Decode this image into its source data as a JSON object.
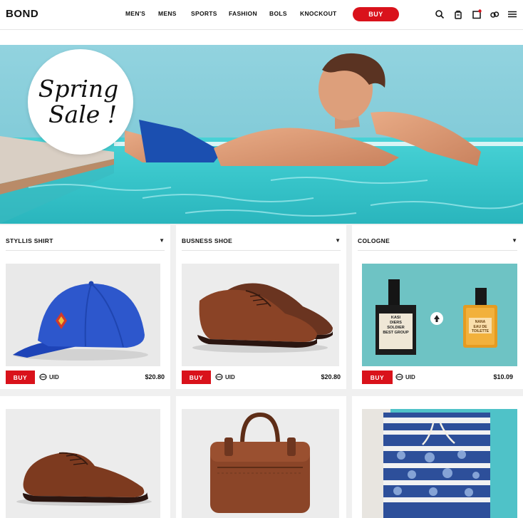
{
  "header": {
    "brand": "BOND",
    "nav": [
      "MEN'S",
      "MENS",
      "SPORTS",
      "FASHION",
      "BOLS",
      "KNOCKOUT"
    ],
    "buy_label": "BUY",
    "icons": [
      "search-icon",
      "bag-icon",
      "calendar-icon",
      "link-icon",
      "menu-icon"
    ]
  },
  "hero": {
    "line1": "Spring",
    "line2": "Sale !"
  },
  "products": [
    {
      "title": "STYLLIS SHIRT",
      "buy": "BUY",
      "currency": "UID",
      "price": "$20.80"
    },
    {
      "title": "BUSNESS SHOE",
      "buy": "BUY",
      "currency": "UID",
      "price": "$20.80"
    },
    {
      "title": "COLOGNE",
      "buy": "BUY",
      "currency": "UID",
      "price": "$10.09"
    }
  ],
  "cologne": {
    "left_label": [
      "KASI",
      "DIERS",
      "SOLDIER",
      "BEST GROUP"
    ],
    "right_label": [
      "NANA",
      "EAU DE",
      "TOILETTE"
    ]
  },
  "colors": {
    "accent": "#d9121b",
    "pool": "#3dc7cc"
  }
}
